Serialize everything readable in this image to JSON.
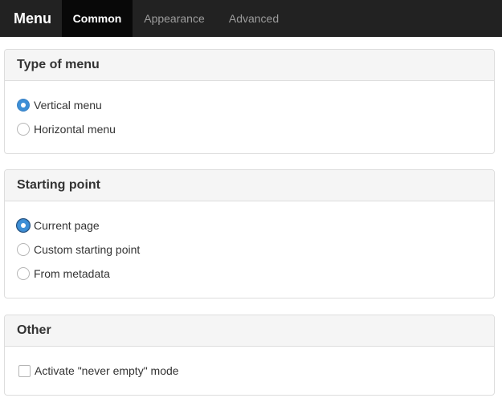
{
  "header": {
    "brand": "Menu",
    "tabs": [
      {
        "label": "Common",
        "active": true
      },
      {
        "label": "Appearance",
        "active": false
      },
      {
        "label": "Advanced",
        "active": false
      }
    ]
  },
  "sections": {
    "type_of_menu": {
      "title": "Type of menu",
      "options": [
        {
          "label": "Vertical menu",
          "checked": true
        },
        {
          "label": "Horizontal menu",
          "checked": false
        }
      ]
    },
    "starting_point": {
      "title": "Starting point",
      "options": [
        {
          "label": "Current page",
          "checked": true
        },
        {
          "label": "Custom starting point",
          "checked": false
        },
        {
          "label": "From metadata",
          "checked": false
        }
      ]
    },
    "other": {
      "title": "Other",
      "options": [
        {
          "label": "Activate \"never empty\" mode",
          "checked": false
        }
      ]
    }
  },
  "colors": {
    "navbar": "#222222",
    "active_tab": "#080808",
    "accent": "#3d8fd6"
  }
}
